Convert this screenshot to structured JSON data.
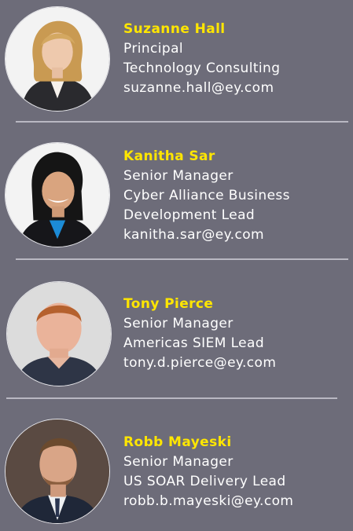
{
  "contacts": [
    {
      "name": "Suzanne Hall",
      "title": "Principal",
      "role_lines": [
        "Technology Consulting"
      ],
      "email": "suzanne.hall@ey.com",
      "photo": "woman-blonde-portrait"
    },
    {
      "name": "Kanitha Sar",
      "title": "Senior Manager",
      "role_lines": [
        "Cyber Alliance Business",
        "Development Lead"
      ],
      "email": "kanitha.sar@ey.com",
      "photo": "woman-dark-hair-portrait"
    },
    {
      "name": "Tony Pierce",
      "title": "Senior Manager",
      "role_lines": [
        "Americas SIEM Lead"
      ],
      "email": "tony.d.pierce@ey.com",
      "photo": "man-red-hair-portrait"
    },
    {
      "name": "Robb Mayeski",
      "title": "Senior Manager",
      "role_lines": [
        "US SOAR Delivery Lead"
      ],
      "email": "robb.b.mayeski@ey.com",
      "photo": "man-suit-portrait"
    }
  ],
  "colors": {
    "background": "#6d6c79",
    "name_accent": "#ffe600",
    "text": "#ffffff",
    "divider": "#b9b8c2"
  }
}
